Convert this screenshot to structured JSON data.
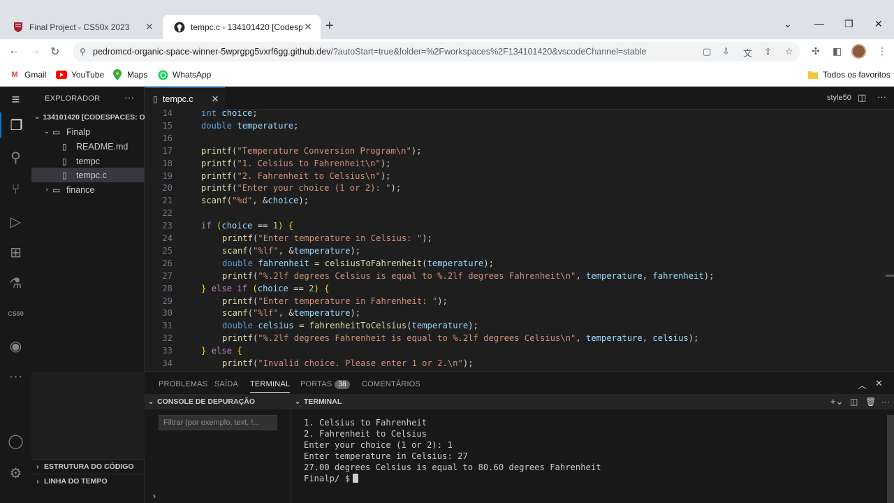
{
  "browser": {
    "tabs": [
      {
        "title": "Final Project - CS50x 2023"
      },
      {
        "title": "tempc.c - 134101420 [Codespaces"
      }
    ],
    "url_host": "pedromcd-organic-space-winner-5wprgpg5vxrf6gg.github.dev",
    "url_path": "/?autoStart=true&folder=%2Fworkspaces%2F134101420&vscodeChannel=stable",
    "bookmarks": [
      "Gmail",
      "YouTube",
      "Maps",
      "WhatsApp"
    ],
    "all_bookmarks": "Todos os favoritos"
  },
  "explorer": {
    "title": "EXPLORADOR",
    "root": "134101420 [CODESPACES: O...",
    "items": [
      {
        "label": "Finalp",
        "type": "folder-open"
      },
      {
        "label": "README.md",
        "type": "file"
      },
      {
        "label": "tempc",
        "type": "file"
      },
      {
        "label": "tempc.c",
        "type": "file",
        "selected": true
      },
      {
        "label": "finance",
        "type": "folder"
      }
    ],
    "outline": "ESTRUTURA DO CÓDIGO",
    "timeline": "LINHA DO TEMPO"
  },
  "activity": {
    "cs50_label": "CS50"
  },
  "editor": {
    "tab_label": "tempc.c",
    "right_label": "style50",
    "lines": [
      {
        "n": "14",
        "indent": 1,
        "html": "<span class='k'>int</span> <span class='v'>choice</span>;"
      },
      {
        "n": "15",
        "indent": 1,
        "html": "<span class='k'>double</span> <span class='v'>temperature</span>;"
      },
      {
        "n": "16",
        "indent": 0,
        "html": ""
      },
      {
        "n": "17",
        "indent": 1,
        "html": "<span class='fn'>printf</span>(<span class='s'>\"Temperature Conversion Program\\n\"</span>);"
      },
      {
        "n": "18",
        "indent": 1,
        "html": "<span class='fn'>printf</span>(<span class='s'>\"1. Celsius to Fahrenheit\\n\"</span>);"
      },
      {
        "n": "19",
        "indent": 1,
        "html": "<span class='fn'>printf</span>(<span class='s'>\"2. Fahrenheit to Celsius\\n\"</span>);"
      },
      {
        "n": "20",
        "indent": 1,
        "html": "<span class='fn'>printf</span>(<span class='s'>\"Enter your choice (1 or 2): \"</span>);"
      },
      {
        "n": "21",
        "indent": 1,
        "html": "<span class='fn'>scanf</span>(<span class='s'>\"%d\"</span>, &amp;<span class='v'>choice</span>);"
      },
      {
        "n": "22",
        "indent": 0,
        "html": ""
      },
      {
        "n": "23",
        "indent": 1,
        "html": "<span class='kc'>if</span> <span class='br'>(</span><span class='v'>choice</span> == <span class='n'>1</span><span class='br'>)</span> <span class='br'>{</span>"
      },
      {
        "n": "24",
        "indent": 2,
        "html": "<span class='fn'>printf</span>(<span class='s'>\"Enter temperature in Celsius: \"</span>);"
      },
      {
        "n": "25",
        "indent": 2,
        "html": "<span class='fn'>scanf</span>(<span class='s'>\"%lf\"</span>, &amp;<span class='v'>temperature</span>);"
      },
      {
        "n": "26",
        "indent": 2,
        "html": "<span class='k'>double</span> <span class='v'>fahrenheit</span> = <span class='fn'>celsiusToFahrenheit</span>(<span class='v'>temperature</span>);"
      },
      {
        "n": "27",
        "indent": 2,
        "html": "<span class='fn'>printf</span>(<span class='s'>\"%.2lf degrees Celsius is equal to %.2lf degrees Fahrenheit\\n\"</span>, <span class='v'>temperature</span>, <span class='v'>fahrenheit</span>);"
      },
      {
        "n": "28",
        "indent": 1,
        "html": "<span class='br'>}</span> <span class='kc'>else if</span> <span class='br'>(</span><span class='v'>choice</span> == <span class='n'>2</span><span class='br'>)</span> <span class='br'>{</span>"
      },
      {
        "n": "29",
        "indent": 2,
        "html": "<span class='fn'>printf</span>(<span class='s'>\"Enter temperature in Fahrenheit: \"</span>);"
      },
      {
        "n": "30",
        "indent": 2,
        "html": "<span class='fn'>scanf</span>(<span class='s'>\"%lf\"</span>, &amp;<span class='v'>temperature</span>);"
      },
      {
        "n": "31",
        "indent": 2,
        "html": "<span class='k'>double</span> <span class='v'>celsius</span> = <span class='fn'>fahrenheitToCelsius</span>(<span class='v'>temperature</span>);"
      },
      {
        "n": "32",
        "indent": 2,
        "html": "<span class='fn'>printf</span>(<span class='s'>\"%.2lf degrees Fahrenheit is equal to %.2lf degrees Celsius\\n\"</span>, <span class='v'>temperature</span>, <span class='v'>celsius</span>);"
      },
      {
        "n": "33",
        "indent": 1,
        "html": "<span class='br'>}</span> <span class='kc'>else</span> <span class='br'>{</span>"
      },
      {
        "n": "34",
        "indent": 2,
        "html": "<span class='fn'>printf</span>(<span class='s'>\"Invalid choice. Please enter 1 or 2.\\n\"</span>);"
      }
    ]
  },
  "panel": {
    "tabs": [
      "PROBLEMAS",
      "SAÍDA",
      "TERMINAL",
      "PORTAS",
      "COMENTÁRIOS"
    ],
    "ports_count": "38",
    "debug_console": "CONSOLE DE DEPURAÇÃO",
    "filter_placeholder": "Filtrar (por exemplo, text, !...",
    "terminal_title": "TERMINAL",
    "terminal_lines": [
      "1. Celsius to Fahrenheit",
      "2. Fahrenheit to Celsius",
      "Enter your choice (1 or 2): 1",
      "Enter temperature in Celsius: 27",
      "27.00 degrees Celsius is equal to 80.60 degrees Fahrenheit"
    ],
    "prompt": "Finalp/ $"
  }
}
